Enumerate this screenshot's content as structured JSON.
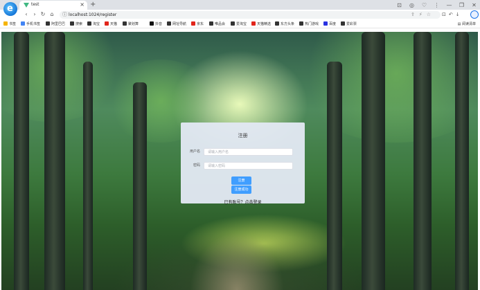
{
  "browser": {
    "tab": {
      "title": "test",
      "close": "×"
    },
    "new_tab": "+",
    "window_controls": [
      "⊡",
      "◎",
      "♡",
      "⋮",
      "—",
      "❐",
      "✕"
    ],
    "nav": {
      "back": "‹",
      "forward": "›",
      "reload": "↻",
      "home": "⌂"
    },
    "address": {
      "url": "localhost:1024/register",
      "lock": "ⓘ"
    },
    "bookmarks": [
      {
        "label": "书签",
        "color": "#f5b400"
      },
      {
        "label": "手机书签",
        "color": "#4285f4"
      },
      {
        "label": "阿里巴巴",
        "color": "#333333"
      },
      {
        "label": "搜索",
        "color": "#333333"
      },
      {
        "label": "淘宝",
        "color": "#333333"
      },
      {
        "label": "天猫",
        "color": "#e1251b"
      },
      {
        "label": "聚划算",
        "color": "#333333"
      },
      {
        "label": "抖音",
        "color": "#111111"
      },
      {
        "label": "网址导航",
        "color": "#333333"
      },
      {
        "label": "京东",
        "color": "#e1251b"
      },
      {
        "label": "唯品会",
        "color": "#333333"
      },
      {
        "label": "爱淘宝",
        "color": "#333333"
      },
      {
        "label": "天猫精选",
        "color": "#e1251b"
      },
      {
        "label": "东方头条",
        "color": "#333333"
      },
      {
        "label": "热门游戏",
        "color": "#333333"
      },
      {
        "label": "百度",
        "color": "#2932e1"
      },
      {
        "label": "爱彩票",
        "color": "#333333"
      }
    ],
    "reading_list": "阅读清单"
  },
  "register_form": {
    "title": "注册",
    "username": {
      "label": "用户名",
      "placeholder": "请输入用户名",
      "value": ""
    },
    "password": {
      "label": "密码",
      "placeholder": "请输入密码",
      "value": ""
    },
    "register_button": "注册",
    "register_success_button": "注册成功",
    "login_link": "已有账号？点击登录"
  },
  "colors": {
    "primary": "#409eff",
    "card_bg": "#e2e8f3"
  }
}
